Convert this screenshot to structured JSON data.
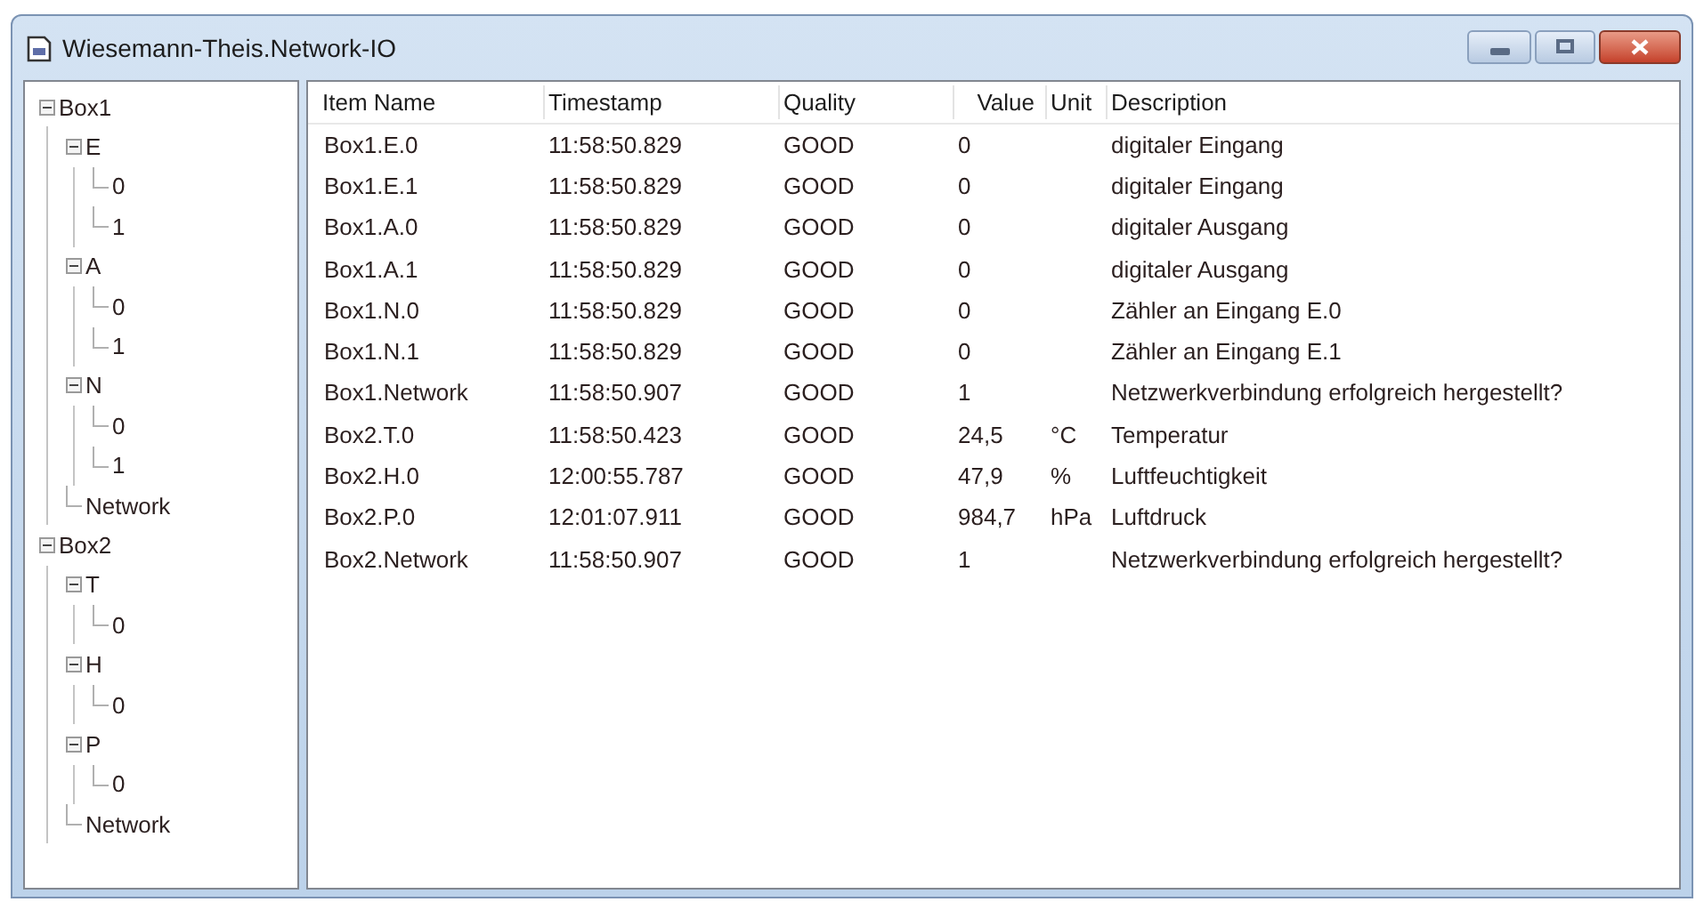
{
  "window": {
    "title": "Wiesemann-Theis.Network-IO"
  },
  "tree": [
    {
      "label": "Box1",
      "expanded": true,
      "children": [
        {
          "label": "E",
          "expanded": true,
          "children": [
            {
              "label": "0"
            },
            {
              "label": "1"
            }
          ]
        },
        {
          "label": "A",
          "expanded": true,
          "children": [
            {
              "label": "0"
            },
            {
              "label": "1"
            }
          ]
        },
        {
          "label": "N",
          "expanded": true,
          "children": [
            {
              "label": "0"
            },
            {
              "label": "1"
            }
          ]
        },
        {
          "label": "Network"
        }
      ]
    },
    {
      "label": "Box2",
      "expanded": true,
      "children": [
        {
          "label": "T",
          "expanded": true,
          "children": [
            {
              "label": "0"
            }
          ]
        },
        {
          "label": "H",
          "expanded": true,
          "children": [
            {
              "label": "0"
            }
          ]
        },
        {
          "label": "P",
          "expanded": true,
          "children": [
            {
              "label": "0"
            }
          ]
        },
        {
          "label": "Network"
        }
      ]
    }
  ],
  "table": {
    "columns": [
      "Item Name",
      "Timestamp",
      "Quality",
      "Value",
      "Unit",
      "Description"
    ],
    "rows": [
      [
        "Box1.E.0",
        "11:58:50.829",
        "GOOD",
        "0",
        "",
        "digitaler Eingang"
      ],
      [
        "Box1.E.1",
        "11:58:50.829",
        "GOOD",
        "0",
        "",
        "digitaler Eingang"
      ],
      [
        "Box1.A.0",
        "11:58:50.829",
        "GOOD",
        "0",
        "",
        "digitaler Ausgang"
      ],
      [
        "Box1.A.1",
        "11:58:50.829",
        "GOOD",
        "0",
        "",
        "digitaler Ausgang"
      ],
      [
        "Box1.N.0",
        "11:58:50.829",
        "GOOD",
        "0",
        "",
        "Zähler an Eingang E.0"
      ],
      [
        "Box1.N.1",
        "11:58:50.829",
        "GOOD",
        "0",
        "",
        "Zähler an Eingang E.1"
      ],
      [
        "Box1.Network",
        "11:58:50.907",
        "GOOD",
        "1",
        "",
        "Netzwerkverbindung erfolgreich hergestellt?"
      ],
      [
        "Box2.T.0",
        "11:58:50.423",
        "GOOD",
        "24,5",
        "°C",
        "Temperatur"
      ],
      [
        "Box2.H.0",
        "12:00:55.787",
        "GOOD",
        "47,9",
        "%",
        "Luftfeuchtigkeit"
      ],
      [
        "Box2.P.0",
        "12:01:07.911",
        "GOOD",
        "984,7",
        "hPa",
        "Luftdruck"
      ],
      [
        "Box2.Network",
        "11:58:50.907",
        "GOOD",
        "1",
        "",
        "Netzwerkverbindung erfolgreich hergestellt?"
      ]
    ]
  }
}
